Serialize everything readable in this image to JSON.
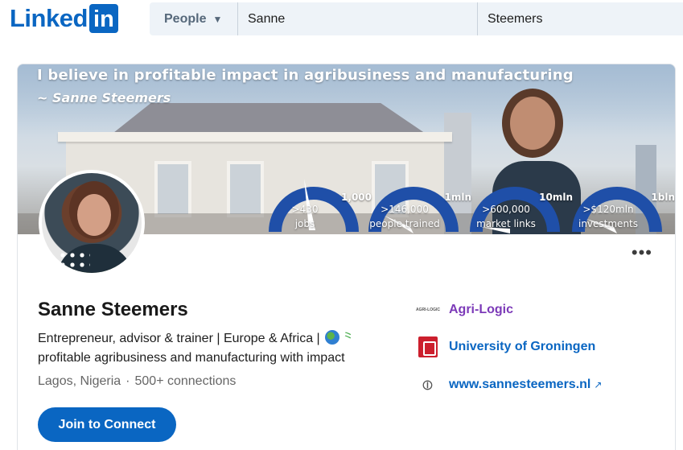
{
  "header": {
    "logo_text": "Linked",
    "logo_box": "in",
    "search": {
      "filter_label": "People",
      "first_name": "Sanne",
      "last_name": "Steemers"
    }
  },
  "banner": {
    "quote": "I believe in profitable impact in agribusiness and manufacturing",
    "author": "~ Sanne Steemers",
    "gauges": [
      {
        "max": "1,000",
        "value": ">430",
        "caption": "jobs"
      },
      {
        "max": "1mln",
        "value": ">146,000",
        "caption": "people trained"
      },
      {
        "max": "10mln",
        "value": ">600,000",
        "caption": "market links"
      },
      {
        "max": "1bln",
        "value": ">$120mln",
        "caption": "investments"
      }
    ]
  },
  "profile": {
    "name": "Sanne Steemers",
    "headline_line1": "Entrepreneur, advisor & trainer | Europe & Africa |",
    "headline_line2": "profitable agribusiness and manufacturing with impact",
    "location": "Lagos, Nigeria",
    "connections": "500+ connections",
    "join_label": "Join to Connect",
    "more_label": "•••"
  },
  "side": {
    "company": "Agri-Logic",
    "company_logo_text": "AGRI-LOGIC",
    "education": "University of Groningen",
    "website": "www.sannesteemers.nl"
  },
  "colors": {
    "brand_blue": "#0a66c2",
    "company_purple": "#7c3ab8",
    "university_red": "#cc1f2d",
    "gauge_blue": "#1f4fa8"
  }
}
